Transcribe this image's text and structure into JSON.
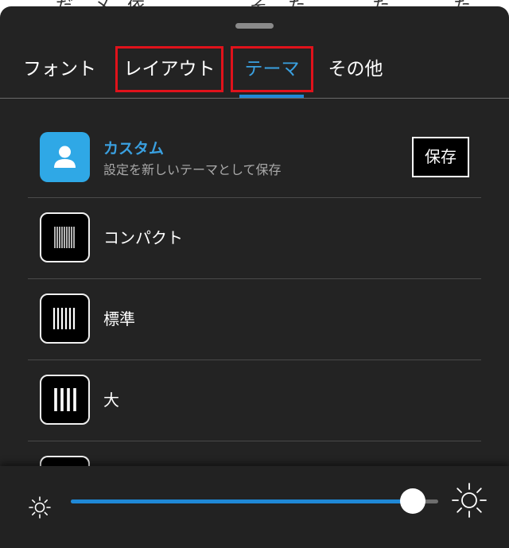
{
  "background_text": [
    "だ",
    "メ",
    "依",
    "そ",
    "た",
    "た",
    "た"
  ],
  "tabs": [
    {
      "label": "フォント",
      "active": false,
      "highlighted": false
    },
    {
      "label": "レイアウト",
      "active": false,
      "highlighted": true
    },
    {
      "label": "テーマ",
      "active": true,
      "highlighted": true
    },
    {
      "label": "その他",
      "active": false,
      "highlighted": false
    }
  ],
  "themes": {
    "custom": {
      "title": "カスタム",
      "subtitle": "設定を新しいテーマとして保存",
      "save_label": "保存",
      "icon": "person-icon"
    },
    "items": [
      {
        "label": "コンパクト",
        "icon": "compact-lines-icon"
      },
      {
        "label": "標準",
        "icon": "standard-lines-icon"
      },
      {
        "label": "大",
        "icon": "large-lines-icon"
      }
    ]
  },
  "brightness": {
    "value_percent": 93,
    "min_icon": "sun-small-icon",
    "max_icon": "sun-large-icon"
  },
  "colors": {
    "accent": "#3aa0e0",
    "slider": "#1f88d6",
    "highlight_box": "#e0121b",
    "sheet_bg": "#232323"
  }
}
